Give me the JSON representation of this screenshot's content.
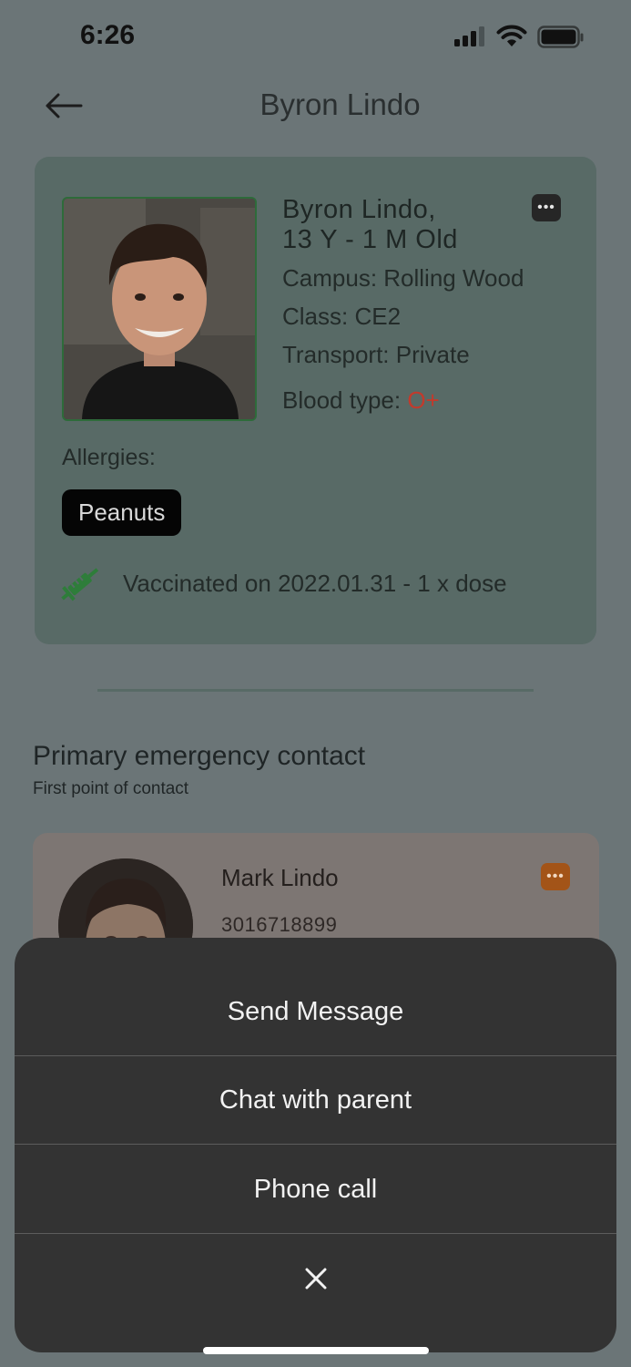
{
  "status_bar": {
    "time": "6:26"
  },
  "header": {
    "title": "Byron Lindo"
  },
  "student": {
    "name_line1": "Byron Lindo,",
    "name_line2": "13 Y - 1 M Old",
    "campus": "Campus: Rolling Wood",
    "class": "Class: CE2",
    "transport": "Transport: Private",
    "blood_label": "Blood type: ",
    "blood_value": "O+",
    "allergies_label": "Allergies:",
    "allergies": [
      "Peanuts"
    ],
    "vaccination": "Vaccinated on 2022.01.31 - 1 x dose",
    "more_label": "•••"
  },
  "emergency": {
    "title": "Primary emergency contact",
    "subtitle": "First point of contact",
    "contact_name": "Mark Lindo",
    "contact_phone": "3016718899",
    "more_label": "•••"
  },
  "action_sheet": {
    "options": [
      "Send Message",
      "Chat with parent",
      "Phone call"
    ],
    "close_label": "✕"
  },
  "colors": {
    "accent_orange": "#a35418",
    "blood_red": "#c23a2c",
    "syringe_green": "#2e7d3a"
  }
}
